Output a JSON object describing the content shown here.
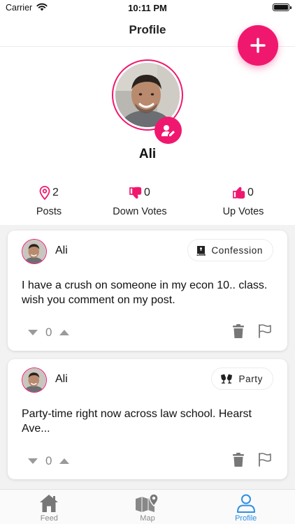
{
  "status_bar": {
    "carrier": "Carrier",
    "time": "10:11 PM"
  },
  "nav": {
    "title": "Profile"
  },
  "colors": {
    "accent": "#f0186e",
    "tab_active": "#2e8fe6",
    "icon_gray": "#7a7a7a"
  },
  "profile": {
    "name": "Ali",
    "stats": [
      {
        "value": "2",
        "label": "Posts",
        "icon": "pin-icon"
      },
      {
        "value": "0",
        "label": "Down Votes",
        "icon": "thumbs-down-icon"
      },
      {
        "value": "0",
        "label": "Up Votes",
        "icon": "thumbs-up-icon"
      }
    ]
  },
  "posts": [
    {
      "author": "Ali",
      "tag": "Confession",
      "tag_icon": "book-icon",
      "text": "I have a crush on someone in my econ 10.. class. wish you comment on my post.",
      "votes": "0"
    },
    {
      "author": "Ali",
      "tag": "Party",
      "tag_icon": "cheers-icon",
      "text": "Party-time right now across law school. Hearst Ave...",
      "votes": "0"
    }
  ],
  "tabs": [
    {
      "label": "Feed",
      "icon": "house-icon",
      "active": false
    },
    {
      "label": "Map",
      "icon": "map-icon",
      "active": false
    },
    {
      "label": "Profile",
      "icon": "person-icon",
      "active": true
    }
  ]
}
